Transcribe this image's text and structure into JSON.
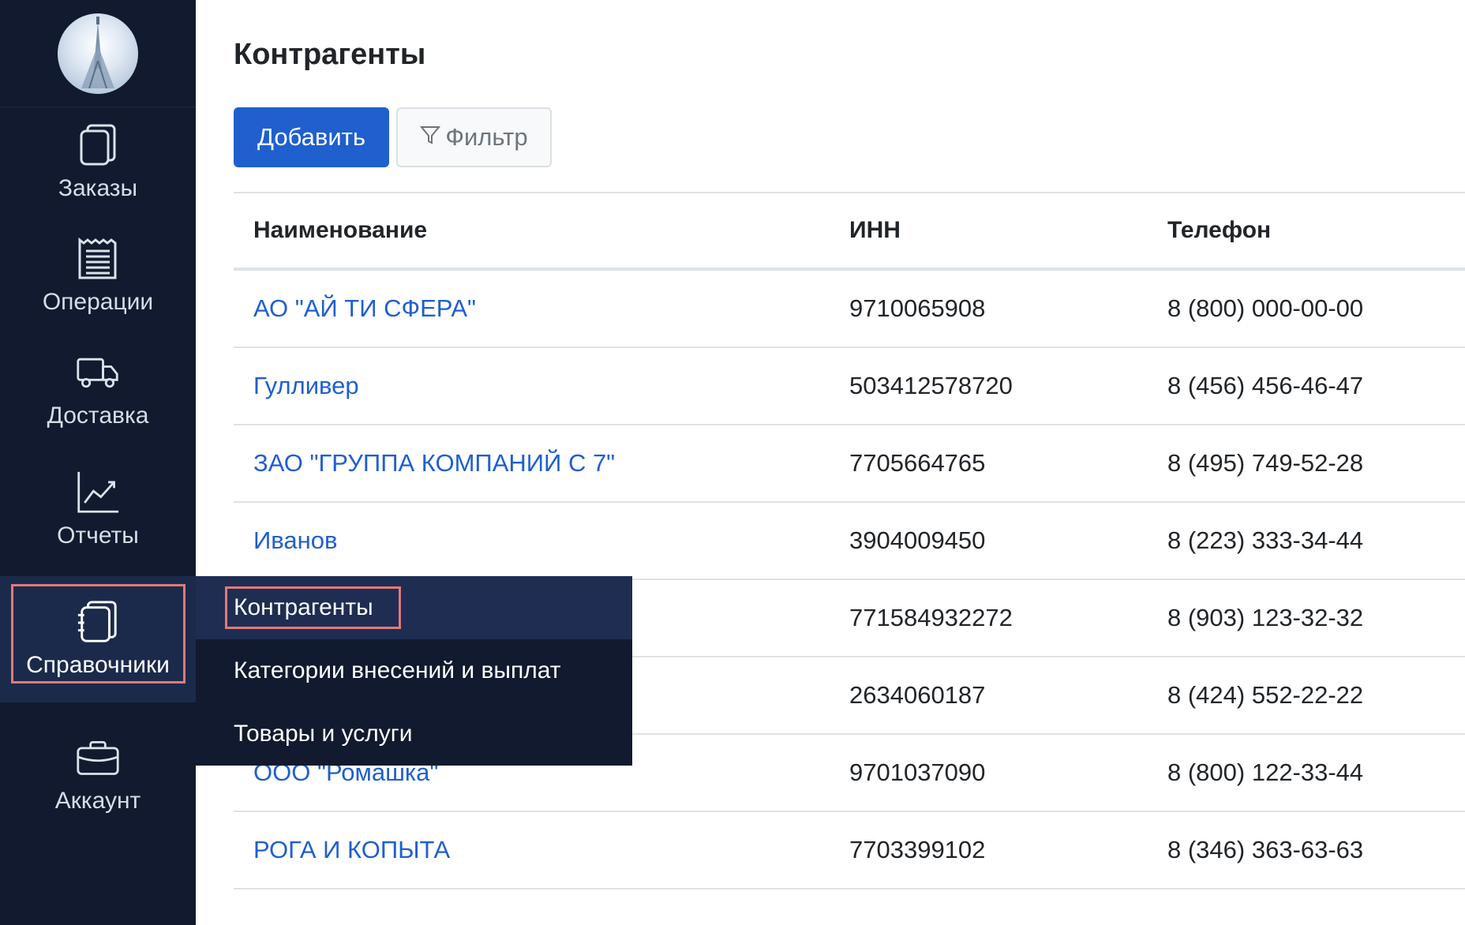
{
  "sidebar": {
    "items": [
      {
        "label": "Заказы",
        "icon": "orders-icon"
      },
      {
        "label": "Операции",
        "icon": "receipt-icon"
      },
      {
        "label": "Доставка",
        "icon": "truck-icon"
      },
      {
        "label": "Отчеты",
        "icon": "chart-icon"
      },
      {
        "label": "Справочники",
        "icon": "notebook-icon"
      },
      {
        "label": "Аккаунт",
        "icon": "briefcase-icon"
      }
    ],
    "active_item": "Справочники"
  },
  "submenu": {
    "items": [
      {
        "label": "Контрагенты"
      },
      {
        "label": "Категории внесений и выплат"
      },
      {
        "label": "Товары и услуги"
      }
    ],
    "active_item": "Контрагенты"
  },
  "main": {
    "title": "Контрагенты",
    "add_label": "Добавить",
    "filter_label": "Фильтр",
    "table": {
      "headers": [
        "Наименование",
        "ИНН",
        "Телефон"
      ],
      "rows": [
        {
          "name": "АО \"АЙ ТИ СФЕРА\"",
          "inn": "9710065908",
          "phone": "8 (800) 000-00-00"
        },
        {
          "name": "Гулливер",
          "inn": "503412578720",
          "phone": "8 (456) 456-46-47"
        },
        {
          "name": "ЗАО \"ГРУППА КОМПАНИЙ С 7\"",
          "inn": "7705664765",
          "phone": "8 (495) 749-52-28"
        },
        {
          "name": "Иванов",
          "inn": "3904009450",
          "phone": "8 (223) 333-34-44"
        },
        {
          "name": "",
          "inn": "771584932272",
          "phone": "8 (903) 123-32-32"
        },
        {
          "name": "",
          "inn": "2634060187",
          "phone": "8 (424) 552-22-22"
        },
        {
          "name": "ООО \"Ромашка\"",
          "inn": "9701037090",
          "phone": "8 (800) 122-33-44"
        },
        {
          "name": "РОГА И КОПЫТА",
          "inn": "7703399102",
          "phone": "8 (346) 363-63-63"
        }
      ]
    }
  },
  "colors": {
    "sidebar_bg": "#111a2e",
    "primary": "#1f5fce",
    "highlight": "#e07a7a"
  }
}
